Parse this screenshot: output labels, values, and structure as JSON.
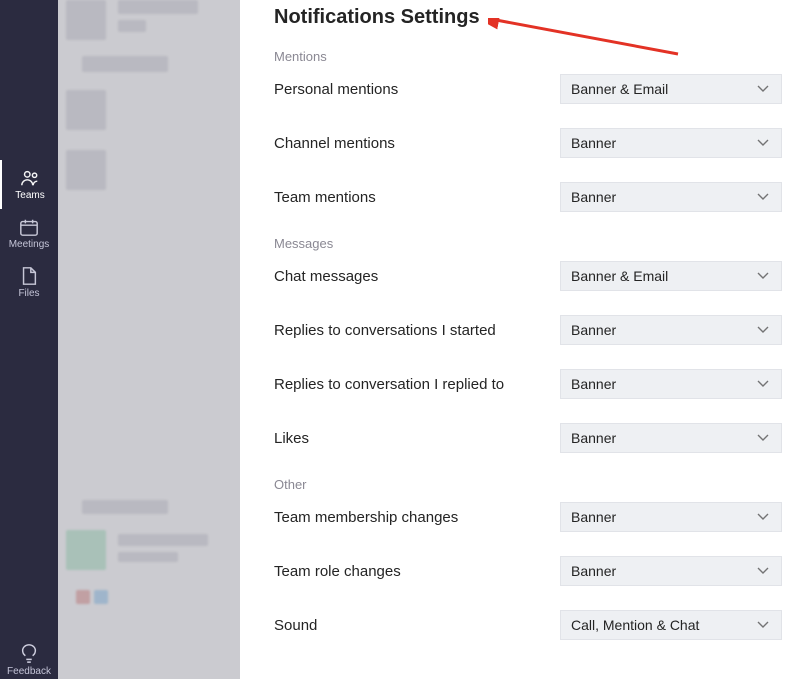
{
  "rail": {
    "items": [
      {
        "name": "teams",
        "label": "Teams"
      },
      {
        "name": "meetings",
        "label": "Meetings"
      },
      {
        "name": "files",
        "label": "Files"
      }
    ],
    "feedback_label": "Feedback"
  },
  "panel": {
    "title": "Notifications Settings",
    "sections": [
      {
        "name": "mentions",
        "heading": "Mentions",
        "rows": [
          {
            "key": "personal_mentions",
            "label": "Personal mentions",
            "value": "Banner & Email"
          },
          {
            "key": "channel_mentions",
            "label": "Channel mentions",
            "value": "Banner"
          },
          {
            "key": "team_mentions",
            "label": "Team mentions",
            "value": "Banner"
          }
        ]
      },
      {
        "name": "messages",
        "heading": "Messages",
        "rows": [
          {
            "key": "chat_messages",
            "label": "Chat messages",
            "value": "Banner & Email"
          },
          {
            "key": "replies_started",
            "label": "Replies to conversations I started",
            "value": "Banner"
          },
          {
            "key": "replies_replied",
            "label": "Replies to conversation I replied to",
            "value": "Banner"
          },
          {
            "key": "likes",
            "label": "Likes",
            "value": "Banner"
          }
        ]
      },
      {
        "name": "other",
        "heading": "Other",
        "rows": [
          {
            "key": "team_membership",
            "label": "Team membership changes",
            "value": "Banner"
          },
          {
            "key": "team_role",
            "label": "Team role changes",
            "value": "Banner"
          },
          {
            "key": "sound",
            "label": "Sound",
            "value": "Call, Mention & Chat"
          }
        ]
      }
    ]
  },
  "annotation": {
    "kind": "arrow",
    "color": "#e33225"
  }
}
